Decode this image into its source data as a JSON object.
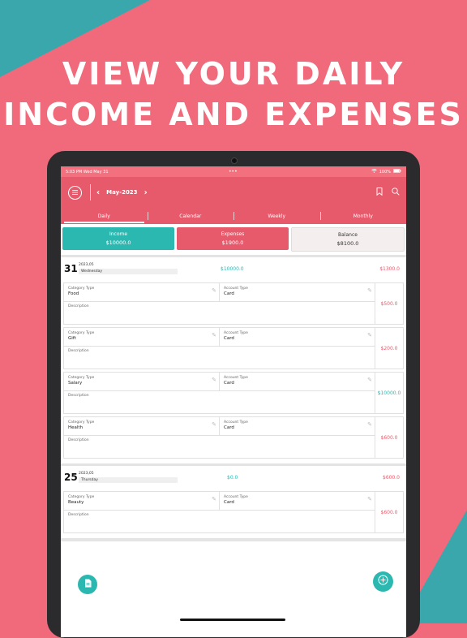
{
  "headline": {
    "line1": "VIEW YOUR DAILY",
    "line2": "INCOME AND EXPENSES"
  },
  "statusbar": {
    "time": "5:03 PM",
    "date": "Wed May 31",
    "dots": "•••",
    "battery": "100%"
  },
  "appbar": {
    "month": "May-2023",
    "prev": "‹",
    "next": "›"
  },
  "tabs": [
    "Daily",
    "Calendar",
    "Weekly",
    "Monthly"
  ],
  "summary": {
    "income_label": "Income",
    "income_value": "$10000.0",
    "expenses_label": "Expenses",
    "expenses_value": "$1900.0",
    "balance_label": "Balance",
    "balance_value": "$8100.0"
  },
  "days": [
    {
      "num": "31",
      "date": "2023,05",
      "weekday": "Wednesday",
      "income": "$10000.0",
      "expense": "$1300.0",
      "entries": [
        {
          "category_label": "Category Type",
          "category": "Food",
          "account_label": "Account Type",
          "account": "Card",
          "description_label": "Description",
          "amount": "$500.0",
          "kind": "expense"
        },
        {
          "category_label": "Category Type",
          "category": "Gift",
          "account_label": "Account Type",
          "account": "Card",
          "description_label": "Description",
          "amount": "$200.0",
          "kind": "expense"
        },
        {
          "category_label": "Category Type",
          "category": "Salary",
          "account_label": "Account Type",
          "account": "Card",
          "description_label": "Description",
          "amount": "$10000.0",
          "kind": "income"
        },
        {
          "category_label": "Category Type",
          "category": "Health",
          "account_label": "Account Type",
          "account": "Card",
          "description_label": "Description",
          "amount": "$600.0",
          "kind": "expense"
        }
      ]
    },
    {
      "num": "25",
      "date": "2023,05",
      "weekday": "Thursday",
      "income": "$0.0",
      "expense": "$600.0",
      "entries": [
        {
          "category_label": "Category Type",
          "category": "Beauty",
          "account_label": "Account Type",
          "account": "Card",
          "description_label": "Description",
          "amount": "$600.0",
          "kind": "expense"
        }
      ]
    }
  ],
  "colors": {
    "brand": "#e65a6c",
    "income": "#2bb8b0",
    "background": "#f06a7b",
    "accent": "#3aa7ac"
  },
  "icons": {
    "menu": "menu-icon",
    "bookmark": "bookmark-icon",
    "search": "search-icon",
    "edit": "edit-icon",
    "report": "report-icon",
    "add": "add-icon"
  }
}
